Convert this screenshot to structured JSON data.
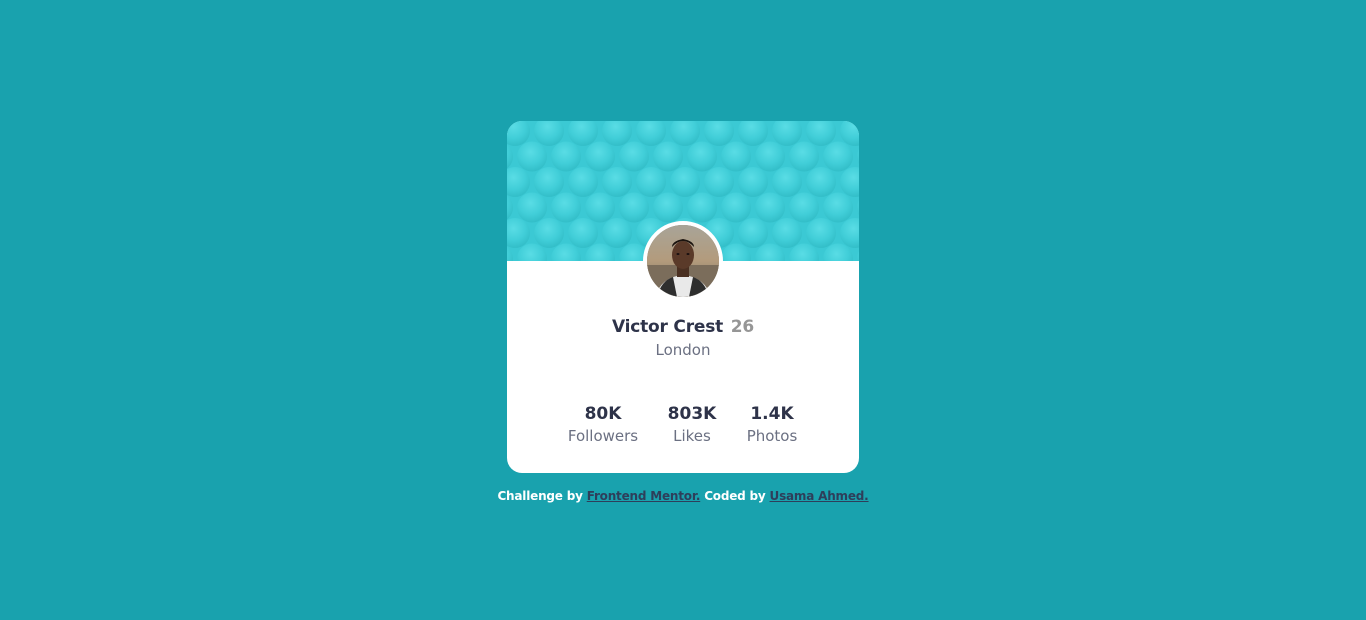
{
  "profile": {
    "name": "Victor Crest",
    "age": "26",
    "city": "London"
  },
  "stats": {
    "followers": {
      "value": "80K",
      "label": "Followers"
    },
    "likes": {
      "value": "803K",
      "label": "Likes"
    },
    "photos": {
      "value": "1.4K",
      "label": "Photos"
    }
  },
  "attribution": {
    "prefix": "Challenge by ",
    "link1": "Frontend Mentor.",
    "middle": " Coded by ",
    "link2": "Usama Ahmed."
  },
  "colors": {
    "background": "#19a2ae",
    "header": "#3bc9d4",
    "card": "#ffffff",
    "text_dark": "#2e3349",
    "text_muted": "#6b7082"
  },
  "icons": {
    "avatar": "profile-photo",
    "header_pattern": "circles-pattern"
  }
}
